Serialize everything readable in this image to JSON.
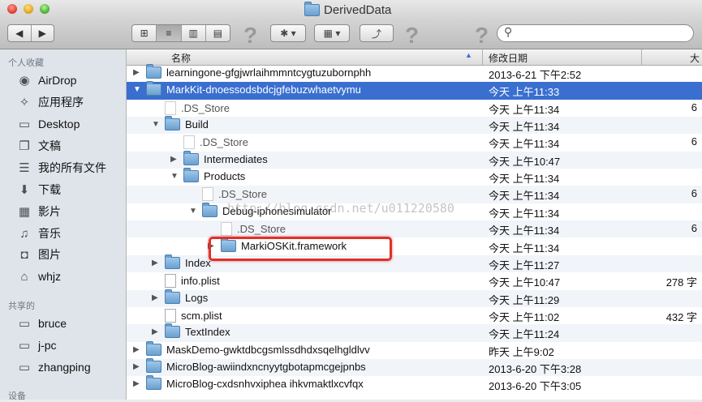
{
  "window": {
    "title": "DerivedData"
  },
  "toolbar": {
    "back_forward": [
      "◀",
      "▶"
    ],
    "views": [
      "⊞",
      "≡",
      "▥",
      "▤"
    ],
    "help1": "?",
    "gear": "✱ ▾",
    "arrange": "▦ ▾",
    "share": "⤴",
    "help2": "?",
    "help3": "?",
    "search_placeholder": ""
  },
  "sidebar": {
    "favorites_header": "个人收藏",
    "favorites": [
      {
        "label": "AirDrop",
        "icon": "airdrop-icon",
        "glyph": "◉"
      },
      {
        "label": "应用程序",
        "icon": "applications-icon",
        "glyph": "✧"
      },
      {
        "label": "Desktop",
        "icon": "desktop-icon",
        "glyph": "▭"
      },
      {
        "label": "文稿",
        "icon": "documents-icon",
        "glyph": "❐"
      },
      {
        "label": "我的所有文件",
        "icon": "all-files-icon",
        "glyph": "☰"
      },
      {
        "label": "下载",
        "icon": "downloads-icon",
        "glyph": "⬇"
      },
      {
        "label": "影片",
        "icon": "movies-icon",
        "glyph": "▦"
      },
      {
        "label": "音乐",
        "icon": "music-icon",
        "glyph": "♫"
      },
      {
        "label": "图片",
        "icon": "pictures-icon",
        "glyph": "◘"
      },
      {
        "label": "whjz",
        "icon": "home-icon",
        "glyph": "⌂"
      }
    ],
    "shared_header": "共享的",
    "shared": [
      {
        "label": "bruce",
        "icon": "computer-icon",
        "glyph": "▭"
      },
      {
        "label": "j-pc",
        "icon": "computer-icon",
        "glyph": "▭"
      },
      {
        "label": "zhangping",
        "icon": "computer-icon",
        "glyph": "▭"
      }
    ],
    "devices_header": "设备"
  },
  "columns": {
    "name": "名称",
    "date": "修改日期",
    "size": "大"
  },
  "rows": [
    {
      "name": "learningone-gfgjwrlaihmmntcygtuzubornphh",
      "date": "2013-6-21 下午2:52",
      "size": "",
      "indent": 0,
      "kind": "folder",
      "disclosure": "▶"
    },
    {
      "name": "MarkKit-dnoessodsbdcjgfebuzwhaetvymu",
      "date": "今天 上午11:33",
      "size": "",
      "indent": 0,
      "kind": "folder",
      "disclosure": "▼",
      "selected": true
    },
    {
      "name": ".DS_Store",
      "date": "今天 上午11:34",
      "size": "6",
      "indent": 1,
      "kind": "file",
      "disclosure": ""
    },
    {
      "name": "Build",
      "date": "今天 上午11:34",
      "size": "",
      "indent": 1,
      "kind": "folder",
      "disclosure": "▼"
    },
    {
      "name": ".DS_Store",
      "date": "今天 上午11:34",
      "size": "6",
      "indent": 2,
      "kind": "file",
      "disclosure": ""
    },
    {
      "name": "Intermediates",
      "date": "今天 上午10:47",
      "size": "",
      "indent": 2,
      "kind": "folder",
      "disclosure": "▶"
    },
    {
      "name": "Products",
      "date": "今天 上午11:34",
      "size": "",
      "indent": 2,
      "kind": "folder",
      "disclosure": "▼"
    },
    {
      "name": ".DS_Store",
      "date": "今天 上午11:34",
      "size": "6",
      "indent": 3,
      "kind": "file",
      "disclosure": ""
    },
    {
      "name": "Debug-iphonesimulator",
      "date": "今天 上午11:34",
      "size": "",
      "indent": 3,
      "kind": "folder",
      "disclosure": "▼"
    },
    {
      "name": ".DS_Store",
      "date": "今天 上午11:34",
      "size": "6",
      "indent": 4,
      "kind": "file",
      "disclosure": ""
    },
    {
      "name": "MarkiOSKit.framework",
      "date": "今天 上午11:34",
      "size": "",
      "indent": 4,
      "kind": "folder",
      "disclosure": "▶"
    },
    {
      "name": "Index",
      "date": "今天 上午11:27",
      "size": "",
      "indent": 1,
      "kind": "folder",
      "disclosure": "▶"
    },
    {
      "name": "info.plist",
      "date": "今天 上午10:47",
      "size": "278 字",
      "indent": 1,
      "kind": "file",
      "disclosure": ""
    },
    {
      "name": "Logs",
      "date": "今天 上午11:29",
      "size": "",
      "indent": 1,
      "kind": "folder",
      "disclosure": "▶"
    },
    {
      "name": "scm.plist",
      "date": "今天 上午11:02",
      "size": "432 字",
      "indent": 1,
      "kind": "file",
      "disclosure": ""
    },
    {
      "name": "TextIndex",
      "date": "今天 上午11:24",
      "size": "",
      "indent": 1,
      "kind": "folder",
      "disclosure": "▶"
    },
    {
      "name": "MaskDemo-gwktdbcgsmlssdhdxsqelhgldlvv",
      "date": "昨天 上午9:02",
      "size": "",
      "indent": 0,
      "kind": "folder",
      "disclosure": "▶"
    },
    {
      "name": "MicroBlog-awiindxncnyytgbotapmcgejpnbs",
      "date": "2013-6-20 下午3:28",
      "size": "",
      "indent": 0,
      "kind": "folder",
      "disclosure": "▶"
    },
    {
      "name": "MicroBlog-cxdsnhvxiphea ihkvmaktlxcvfqx",
      "date": "2013-6-20 下午3:05",
      "size": "",
      "indent": 0,
      "kind": "folder",
      "disclosure": "▶"
    }
  ],
  "watermark": "http://blog.csdn.net/u011220580"
}
